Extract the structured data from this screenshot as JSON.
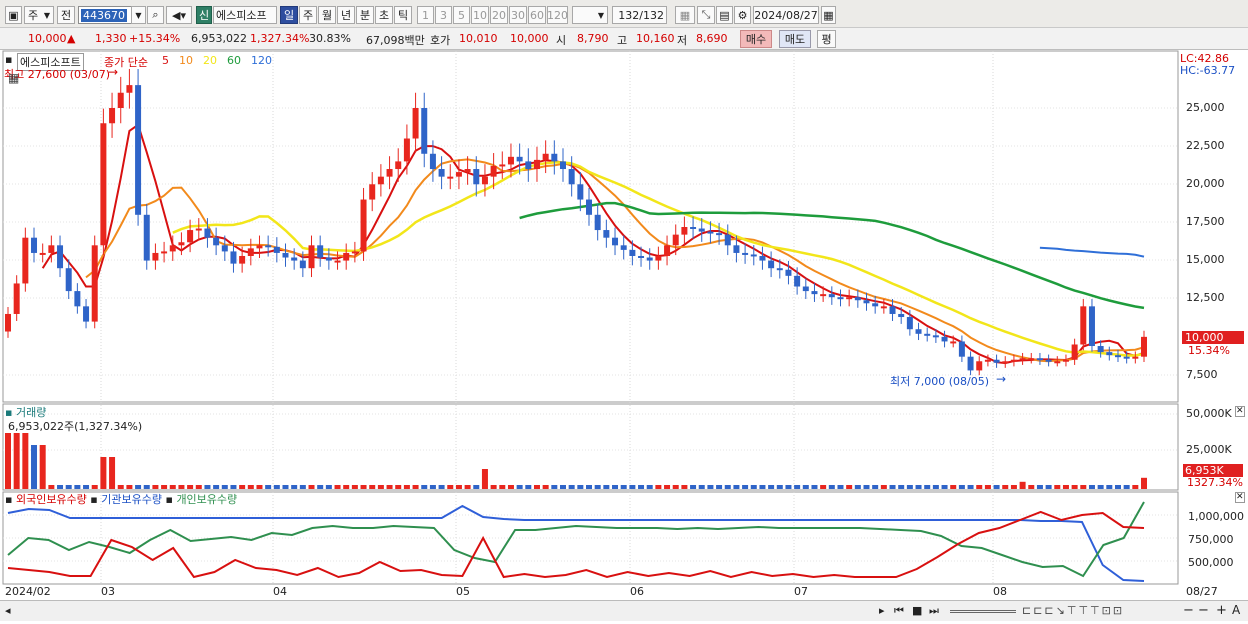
{
  "toolbar": {
    "period_select": "주",
    "all_label": "전",
    "code": "443670",
    "new_badge": "신",
    "stock_name": "에스피소프",
    "tabs": [
      "일",
      "주",
      "월",
      "년",
      "분",
      "초",
      "틱"
    ],
    "minute_units": [
      "1",
      "3",
      "5",
      "10",
      "20",
      "30",
      "60",
      "120"
    ],
    "count": "132",
    "count_total": "/132",
    "date": "2024/08/27"
  },
  "quote": {
    "price": "10,000",
    "up_mark": "▲",
    "change": "1,330",
    "change_pct": "+15.34%",
    "volume": "6,953,022",
    "volume_pct": "1,327.34%",
    "turnover": "30.83%",
    "amount": "67,098백만",
    "hoga_label": "호가",
    "hoga_bid": "10,010",
    "hoga_ask": "10,000",
    "open_label": "시",
    "open": "8,790",
    "high_label": "고",
    "high": "10,160",
    "low_label": "저",
    "low": "8,690",
    "buy_label": "매수",
    "sell_label": "매도",
    "eval_label": "평"
  },
  "price_panel": {
    "name_tag": "에스피소프트",
    "legend_title": "종가 단순",
    "legend": [
      {
        "label": "5",
        "color": "#d81010"
      },
      {
        "label": "10",
        "color": "#f28a1c"
      },
      {
        "label": "20",
        "color": "#f2e61a"
      },
      {
        "label": "60",
        "color": "#1e9c3c"
      },
      {
        "label": "120",
        "color": "#2f6fd8"
      }
    ],
    "max_label": "최고 27,600 (03/07)",
    "min_label": "최저 7,000 (08/05)",
    "lc": "LC:42.86",
    "hc": "HC:-63.77",
    "last_price_tag": "10,000",
    "last_pct_tag": "15.34%",
    "y_ticks": [
      "25,000",
      "22,500",
      "20,000",
      "17,500",
      "15,000",
      "12,500",
      "7,500"
    ]
  },
  "volume_panel": {
    "title": "거래량",
    "value": "6,953,022주(1,327.34%)",
    "y_ticks": [
      "50,000K",
      "25,000K"
    ],
    "last_tag": "6,953K",
    "last_pct": "1327.34%"
  },
  "holding_panel": {
    "legend": [
      {
        "label": "외국인보유수량",
        "color": "#d81010"
      },
      {
        "label": "기관보유수량",
        "color": "#2f5fd8"
      },
      {
        "label": "개인보유수량",
        "color": "#2f8f4f"
      }
    ],
    "y_ticks": [
      "1,000,000",
      "750,000",
      "500,000"
    ]
  },
  "x_axis": {
    "labels": [
      "2024/02",
      "03",
      "04",
      "05",
      "06",
      "07",
      "08"
    ],
    "end_label": "08/27"
  },
  "colors": {
    "up": "#e8261e",
    "down": "#2f64c8",
    "accent_green": "#2f7f65"
  }
}
